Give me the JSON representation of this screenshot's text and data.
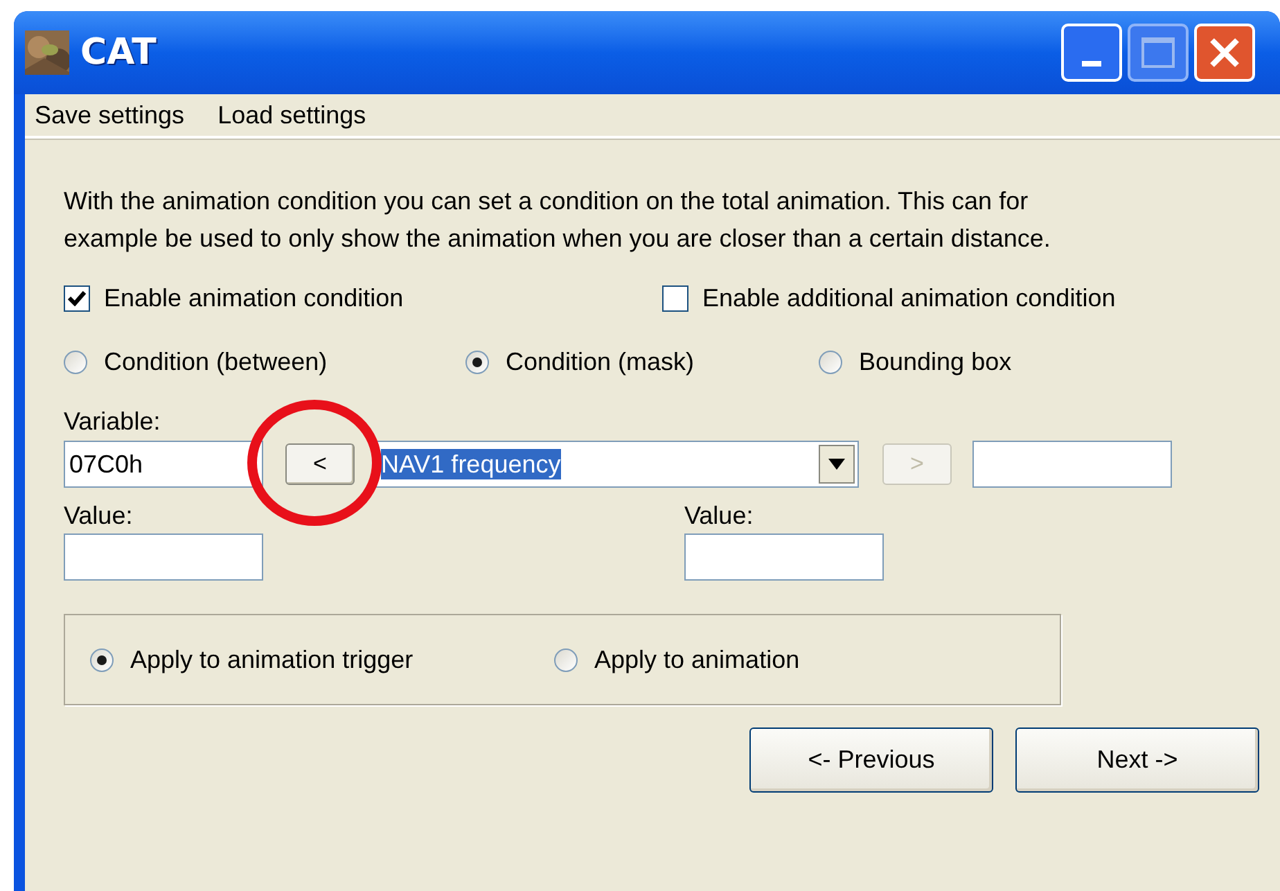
{
  "window": {
    "title": "CAT"
  },
  "menu": [
    {
      "label": "Save settings"
    },
    {
      "label": "Load settings"
    }
  ],
  "description": "With the animation condition you can set a condition on the total animation. This can for example be used to only show the animation when you are closer than a certain distance.",
  "checkboxes": [
    {
      "label": "Enable animation condition",
      "checked": true
    },
    {
      "label": "Enable additional animation condition",
      "checked": false
    }
  ],
  "condition_types": [
    {
      "label": "Condition (between)",
      "selected": false
    },
    {
      "label": "Condition (mask)",
      "selected": true
    },
    {
      "label": "Bounding box",
      "selected": false
    }
  ],
  "variable": {
    "label": "Variable:",
    "value": "07C0h"
  },
  "previous_variable_button": {
    "label": "<",
    "disabled": false
  },
  "variable_combo": {
    "value": "NAV1 frequency"
  },
  "next_variable_button": {
    "label": ">",
    "disabled": true
  },
  "values": [
    {
      "label": "Value:"
    },
    {
      "label": "Value:"
    }
  ],
  "apply_options": [
    {
      "label": "Apply to animation trigger",
      "selected": true
    },
    {
      "label": "Apply to animation",
      "selected": false
    }
  ],
  "nav_buttons": [
    {
      "label": "<- Previous"
    },
    {
      "label": "Next ->"
    }
  ]
}
